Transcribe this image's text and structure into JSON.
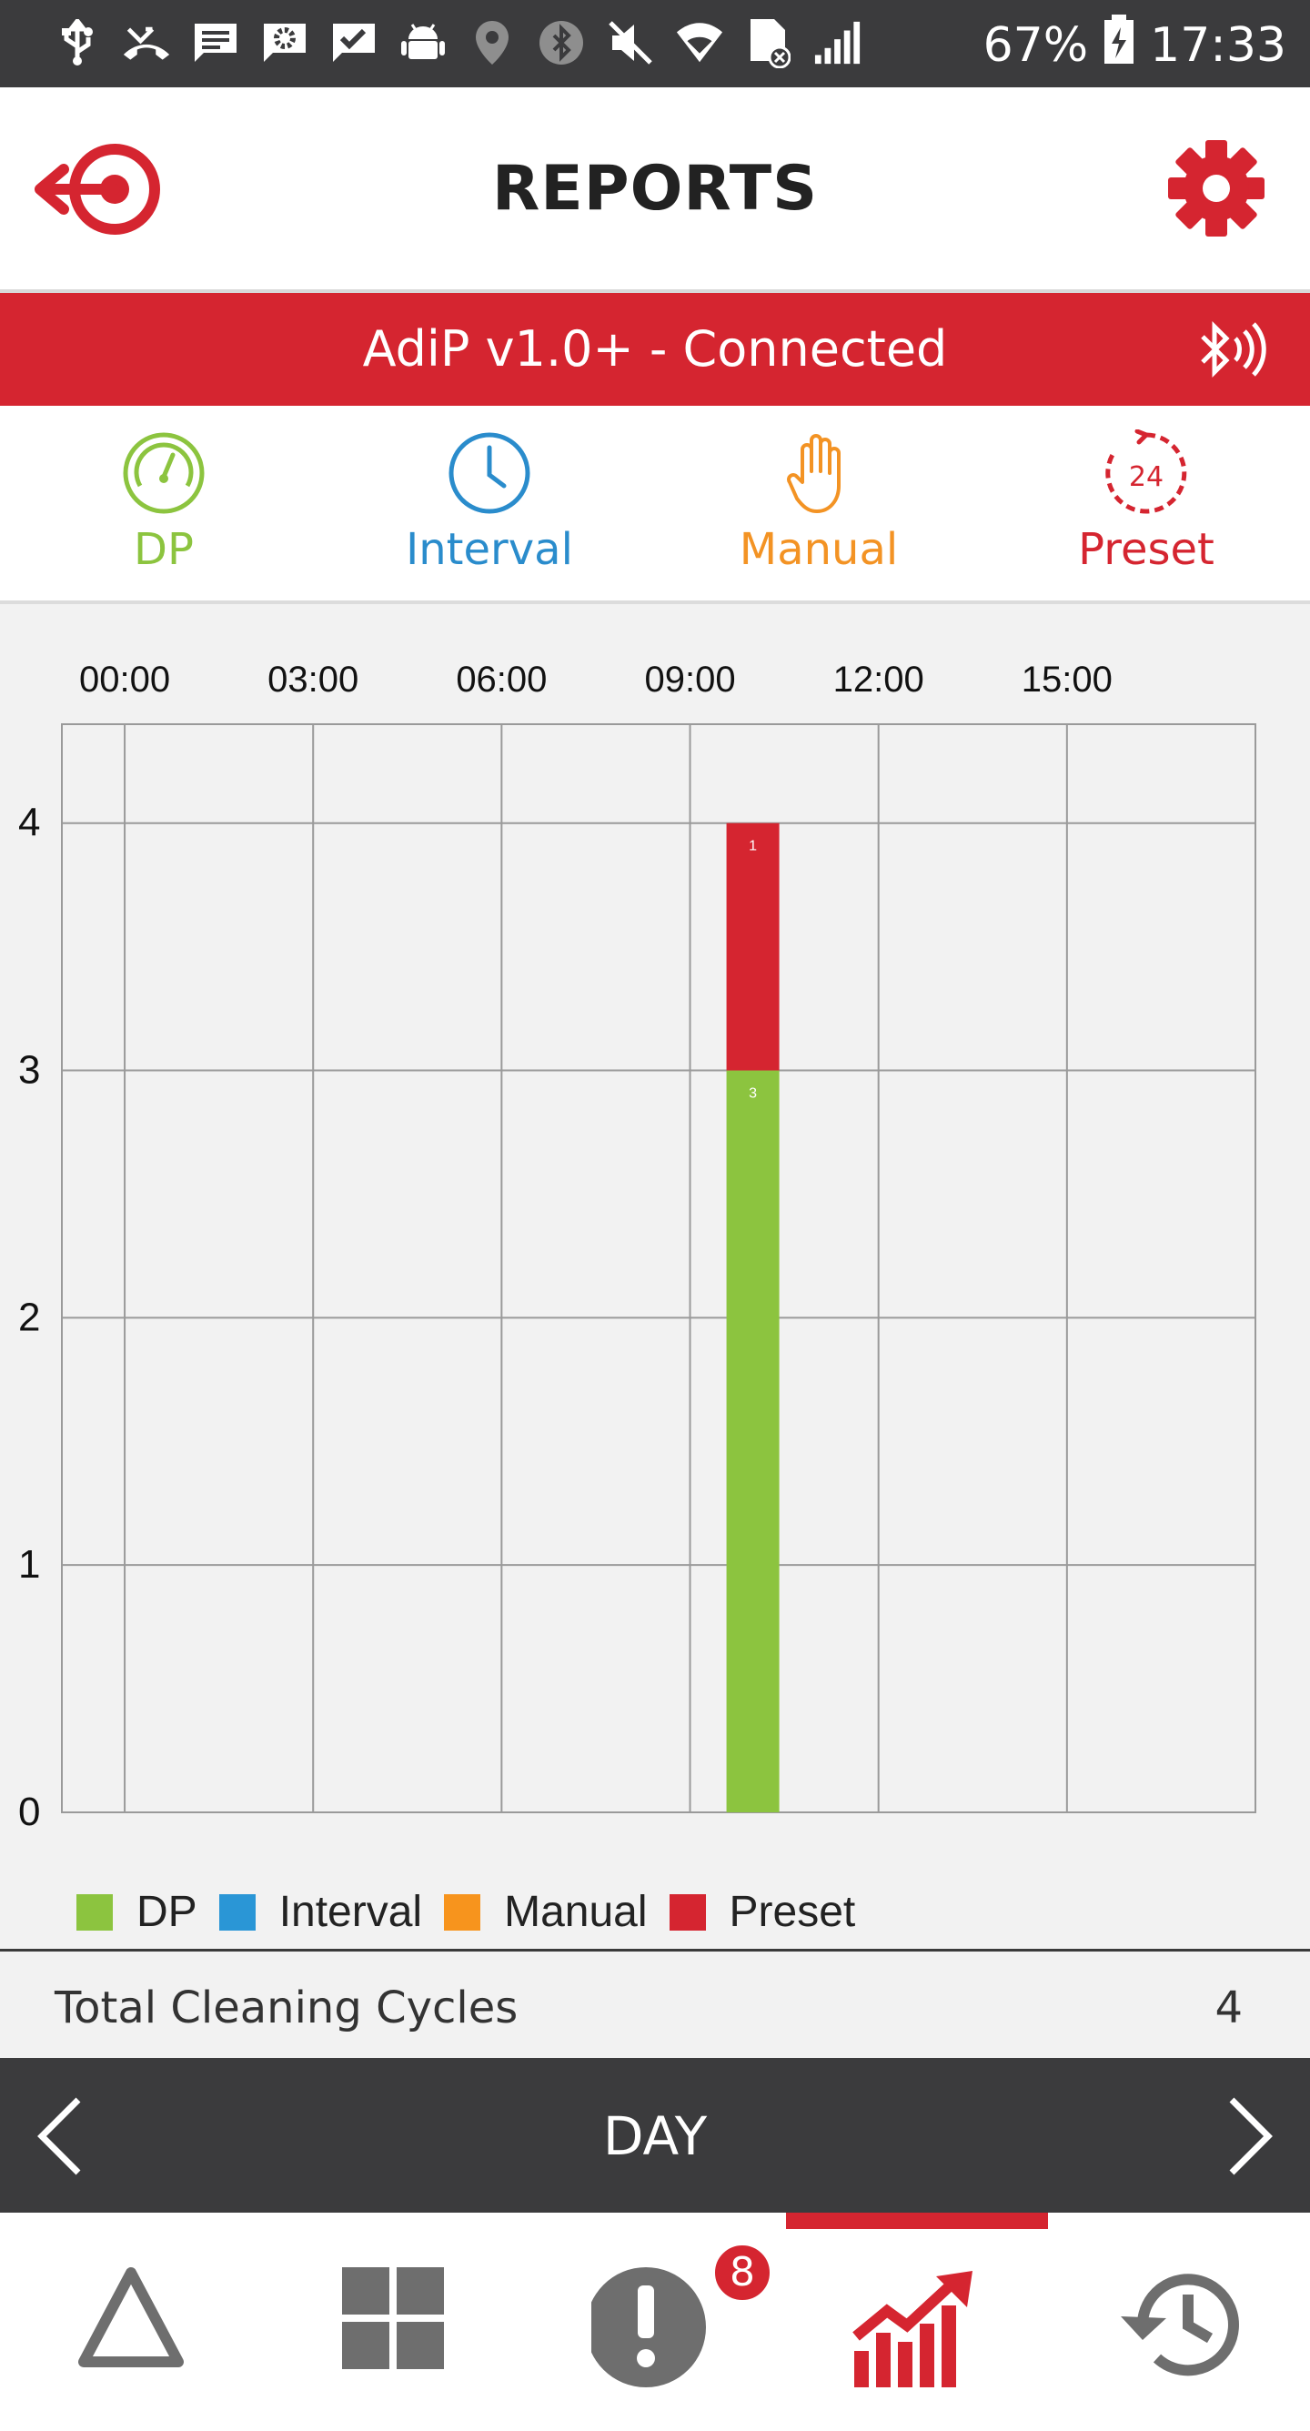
{
  "status_bar": {
    "icons": [
      "usb-icon",
      "missed-call-icon",
      "message-icon",
      "settings-notification-icon",
      "task-icon",
      "android-icon",
      "location-icon",
      "bluetooth-icon",
      "mute-icon",
      "wifi-icon",
      "no-sim-icon",
      "signal-icon"
    ],
    "battery_percent": "67%",
    "time": "17:33"
  },
  "header": {
    "title": "REPORTS",
    "back_icon": "logout-target-icon",
    "settings_icon": "gear-icon"
  },
  "connection": {
    "text": "AdiP v1.0+ - Connected",
    "icon": "bluetooth-signal-icon"
  },
  "modes": [
    {
      "label": "DP",
      "icon": "gauge-icon",
      "color": "#8cc43f"
    },
    {
      "label": "Interval",
      "icon": "clock-icon",
      "color": "#2a8ccc"
    },
    {
      "label": "Manual",
      "icon": "hand-icon",
      "color": "#f39324"
    },
    {
      "label": "Preset",
      "icon": "timer-24-icon",
      "color": "#d52530"
    }
  ],
  "chart_data": {
    "type": "bar",
    "stacked": true,
    "x_ticks": [
      "00:00",
      "03:00",
      "06:00",
      "09:00",
      "12:00",
      "15:00"
    ],
    "x_range_hours": [
      -1,
      18
    ],
    "y_ticks": [
      "0",
      "1",
      "2",
      "3",
      "4"
    ],
    "ylim": [
      0,
      4.4
    ],
    "grid": true,
    "legend_position": "bottom-left",
    "bars": [
      {
        "hour": 10,
        "segments": [
          {
            "series": "DP",
            "value": 3,
            "label": "3"
          },
          {
            "series": "Preset",
            "value": 1,
            "label": "1"
          }
        ]
      }
    ],
    "series": [
      {
        "name": "DP",
        "color": "#8cc43f"
      },
      {
        "name": "Interval",
        "color": "#2a96d6"
      },
      {
        "name": "Manual",
        "color": "#f7941d"
      },
      {
        "name": "Preset",
        "color": "#d52530"
      }
    ]
  },
  "total": {
    "label": "Total Cleaning Cycles",
    "value": "4"
  },
  "period": {
    "label": "DAY",
    "prev_icon": "chevron-left-icon",
    "next_icon": "chevron-right-icon"
  },
  "bottom_nav": {
    "items": [
      "triangle-alert-icon",
      "dashboard-grid-icon",
      "alerts-icon",
      "reports-chart-icon",
      "history-icon"
    ],
    "alerts_badge": "8",
    "active": "reports-chart-icon"
  }
}
